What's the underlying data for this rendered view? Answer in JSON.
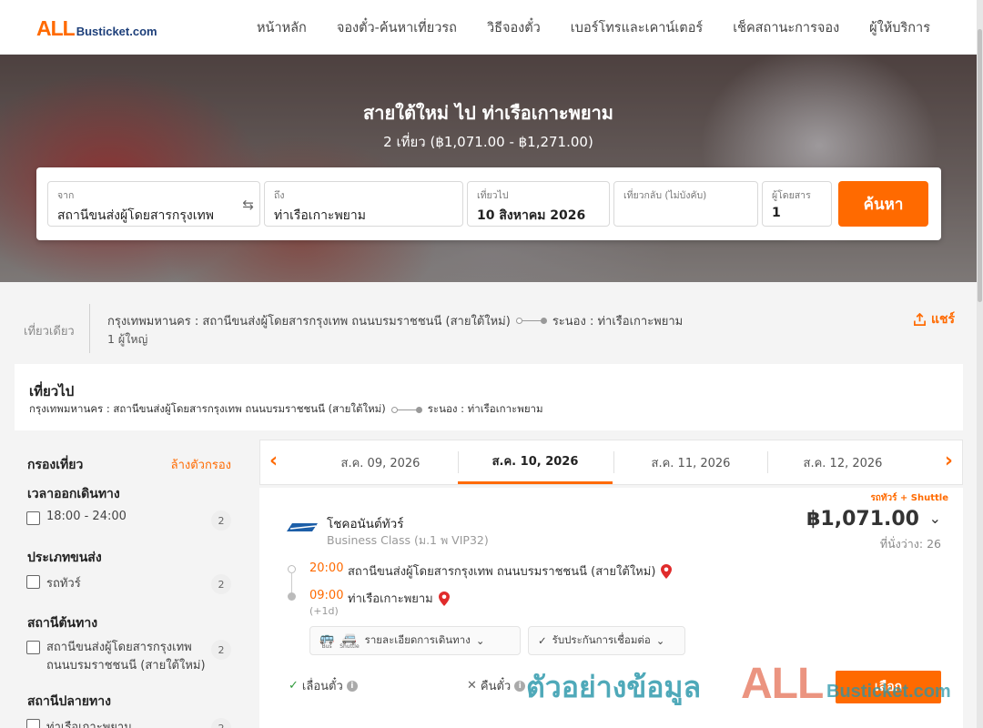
{
  "brand": {
    "logo_all": "ALL",
    "logo_rest": "Busticket.com",
    "accent_color": "#ff6a00",
    "brand_color": "#1d3f7a"
  },
  "nav": {
    "items": [
      "หน้าหลัก",
      "จองตั๋ว-ค้นหาเที่ยวรถ",
      "วิธีจองตั๋ว",
      "เบอร์โทรและเคาน์เตอร์",
      "เช็คสถานะการจอง",
      "ผู้ให้บริการ"
    ]
  },
  "hero": {
    "title": "สายใต้ใหม่ ไป ท่าเรือเกาะพยาม",
    "subtitle": "2 เที่ยว (฿1,071.00 - ฿1,271.00)"
  },
  "search": {
    "from_label": "จาก",
    "from_value": "สถานีขนส่งผู้โดยสารกรุงเทพ",
    "to_label": "ถึง",
    "to_value": "ท่าเรือเกาะพยาม",
    "depart_label": "เที่ยวไป",
    "depart_value": "10 สิงหาคม 2026",
    "return_label": "เที่ยวกลับ (ไม่บังคับ)",
    "return_value": "",
    "pax_label": "ผู้โดยสาร",
    "pax_value": "1",
    "button": "ค้นหา",
    "swap_icon": "swap-arrows-icon"
  },
  "summary": {
    "trip_type": "เที่ยวเดียว",
    "origin": "กรุงเทพมหานคร : สถานีขนส่งผู้โดยสารกรุงเทพ ถนนบรมราชชนนี (สายใต้ใหม่)",
    "destination": "ระนอง : ท่าเรือเกาะพยาม",
    "passengers": "1 ผู้ใหญ่",
    "share": "แชร์"
  },
  "outbound": {
    "title": "เที่ยวไป",
    "origin": "กรุงเทพมหานคร : สถานีขนส่งผู้โดยสารกรุงเทพ ถนนบรมราชชนนี (สายใต้ใหม่)",
    "destination": "ระนอง : ท่าเรือเกาะพยาม"
  },
  "filters": {
    "title": "กรองเที่ยว",
    "clear": "ล้างตัวกรอง",
    "groups": [
      {
        "title": "เวลาออกเดินทาง",
        "options": [
          {
            "label": "18:00 - 24:00",
            "count": "2"
          }
        ]
      },
      {
        "title": "ประเภทขนส่ง",
        "options": [
          {
            "label": "รถทัวร์",
            "count": "2"
          }
        ]
      },
      {
        "title": "สถานีต้นทาง",
        "options": [
          {
            "label": "สถานีขนส่งผู้โดยสารกรุงเทพ",
            "label2": "ถนนบรมราชชนนี (สายใต้ใหม่)",
            "count": "2"
          }
        ]
      },
      {
        "title": "สถานีปลายทาง",
        "options": [
          {
            "label": "ท่าเรือเกาะพยาม",
            "count": "2"
          }
        ]
      }
    ]
  },
  "dates": {
    "tabs": [
      "ส.ค. 09, 2026",
      "ส.ค. 10, 2026",
      "ส.ค. 11, 2026",
      "ส.ค. 12, 2026"
    ],
    "active_index": 1
  },
  "result": {
    "tag": "รถทัวร์ + Shuttle",
    "operator": "โชคอนันต์ทัวร์",
    "bus_class": "Business Class (ม.1 พ VIP32)",
    "price": "฿1,071.00",
    "seats": "ที่นั่งว่าง: 26",
    "depart_time": "20:00",
    "depart_place": "สถานีขนส่งผู้โดยสารกรุงเทพ ถนนบรมราชชนนี (สายใต้ใหม่)",
    "arrive_time": "09:00",
    "arrive_place": "ท่าเรือเกาะพยาม",
    "next_day": "(+1d)",
    "bus_caption": "Bus",
    "shuttle_caption": "Shuttle",
    "details_chip": "รายละเอียดการเดินทาง",
    "guarantee_chip": "รับประกันการเชื่อมต่อ",
    "cond_refundable": "เลื่อนตั๋ว",
    "cond_cancel": "คืนตั๋ว",
    "select_button": "เลือก"
  },
  "watermark": {
    "thai": "ตัวอย่างข้อมูล",
    "all": "ALL",
    "busticket": "Busticket.com"
  }
}
